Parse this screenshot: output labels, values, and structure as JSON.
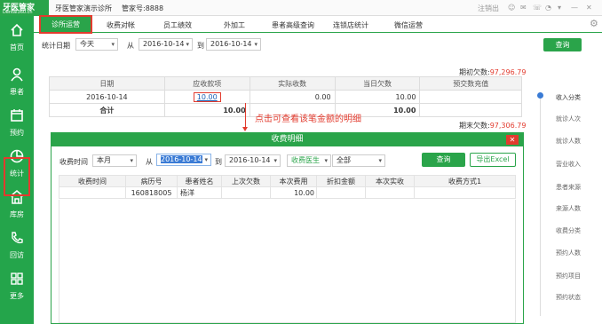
{
  "app": {
    "logo": "牙医管家",
    "logo_sub": "Dental360.cn",
    "clinic": "牙医管家演示诊所",
    "manager": "管家号:8888",
    "logout": "注销出"
  },
  "sidebar": [
    {
      "label": "首页",
      "icon": "home-icon"
    },
    {
      "label": "患者",
      "icon": "user-icon"
    },
    {
      "label": "预约",
      "icon": "calendar-icon"
    },
    {
      "label": "统计",
      "icon": "pie-chart-icon"
    },
    {
      "label": "库房",
      "icon": "warehouse-icon"
    },
    {
      "label": "回访",
      "icon": "phone-icon"
    },
    {
      "label": "更多",
      "icon": "grid-icon"
    }
  ],
  "tabs": [
    "诊所运营",
    "收费对帐",
    "员工绩效",
    "外加工",
    "患者高级查询",
    "连锁店统计",
    "微信运营"
  ],
  "filter": {
    "label": "统计日期",
    "period": "今天",
    "from_label": "从",
    "from": "2016-10-14",
    "to_label": "到",
    "to": "2016-10-14",
    "query": "查询"
  },
  "summary": {
    "opening_label": "期初欠数:",
    "opening": "97,296.79",
    "closing_label": "期末欠数:",
    "closing": "97,306.79"
  },
  "table": {
    "headers": [
      "日期",
      "应收款项",
      "实际收数",
      "当日欠数",
      "预交数充值"
    ],
    "row": [
      "2016-10-14",
      "10.00",
      "0.00",
      "10.00",
      ""
    ],
    "total": [
      "合计",
      "10.00",
      "",
      "10.00",
      ""
    ]
  },
  "annotation": "点击可查看该笔金额的明细",
  "right_nav": [
    "收入分类",
    "就诊人次",
    "就诊人数",
    "营业收入",
    "患者来源",
    "来源人数",
    "收费分类",
    "预约人数",
    "预约项目",
    "预约状态"
  ],
  "modal": {
    "title": "收费明细",
    "time_label": "收费时间",
    "period": "本月",
    "from_label": "从",
    "from": "2016-10-14",
    "to_label": "到",
    "to": "2016-10-14",
    "doctor": "收费医生",
    "all": "全部",
    "query": "查询",
    "export": "导出Excel",
    "headers": [
      "收费时间",
      "病历号",
      "患者姓名",
      "上次欠数",
      "本次费用",
      "折扣金额",
      "本次实收",
      "收费方式1"
    ],
    "row": [
      "",
      "160818005",
      "杨洋",
      "",
      "10.00",
      "",
      "",
      ""
    ]
  }
}
